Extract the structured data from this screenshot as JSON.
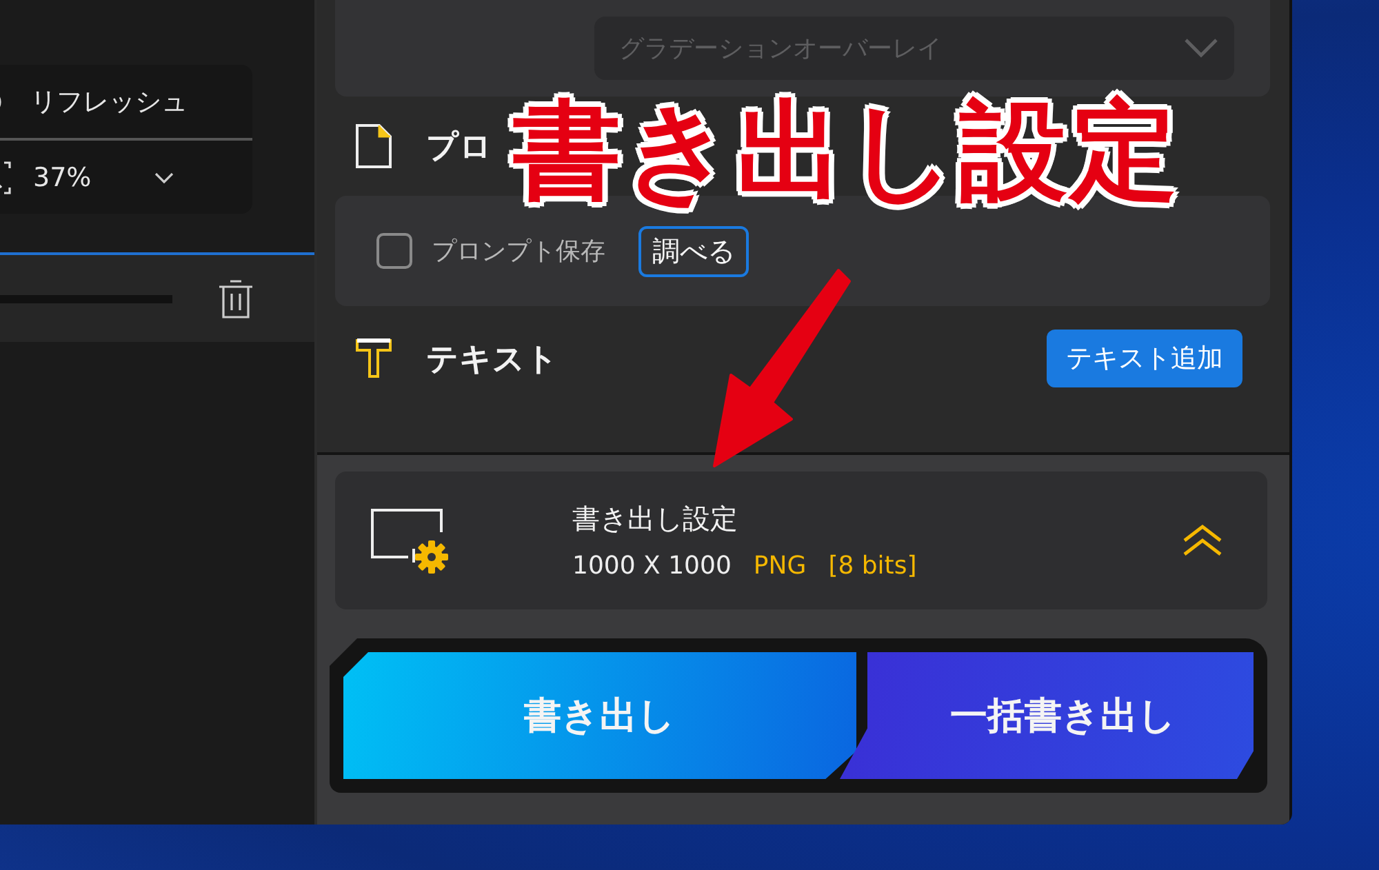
{
  "left_panel": {
    "refresh_label": "リフレッシュ",
    "zoom_value": "37%"
  },
  "style_dropdown": {
    "value": "グラデーションオーバーレイ",
    "disabled": true
  },
  "prompt_section": {
    "title": "プロ"
  },
  "prompt_save": {
    "label": "プロンプト保存",
    "checked": false
  },
  "lookup_button": {
    "label": "調べる"
  },
  "text_section": {
    "title": "テキスト",
    "add_button": "テキスト追加"
  },
  "export_settings": {
    "title": "書き出し設定",
    "size": "1000 X 1000",
    "format": "PNG",
    "bit_depth": "[8 bits]",
    "expanded": true
  },
  "actions": [
    {
      "label": "書き出し",
      "kind": "single"
    },
    {
      "label": "一括書き出し",
      "kind": "batch"
    }
  ],
  "annotation": {
    "text": "書き出し設定"
  }
}
